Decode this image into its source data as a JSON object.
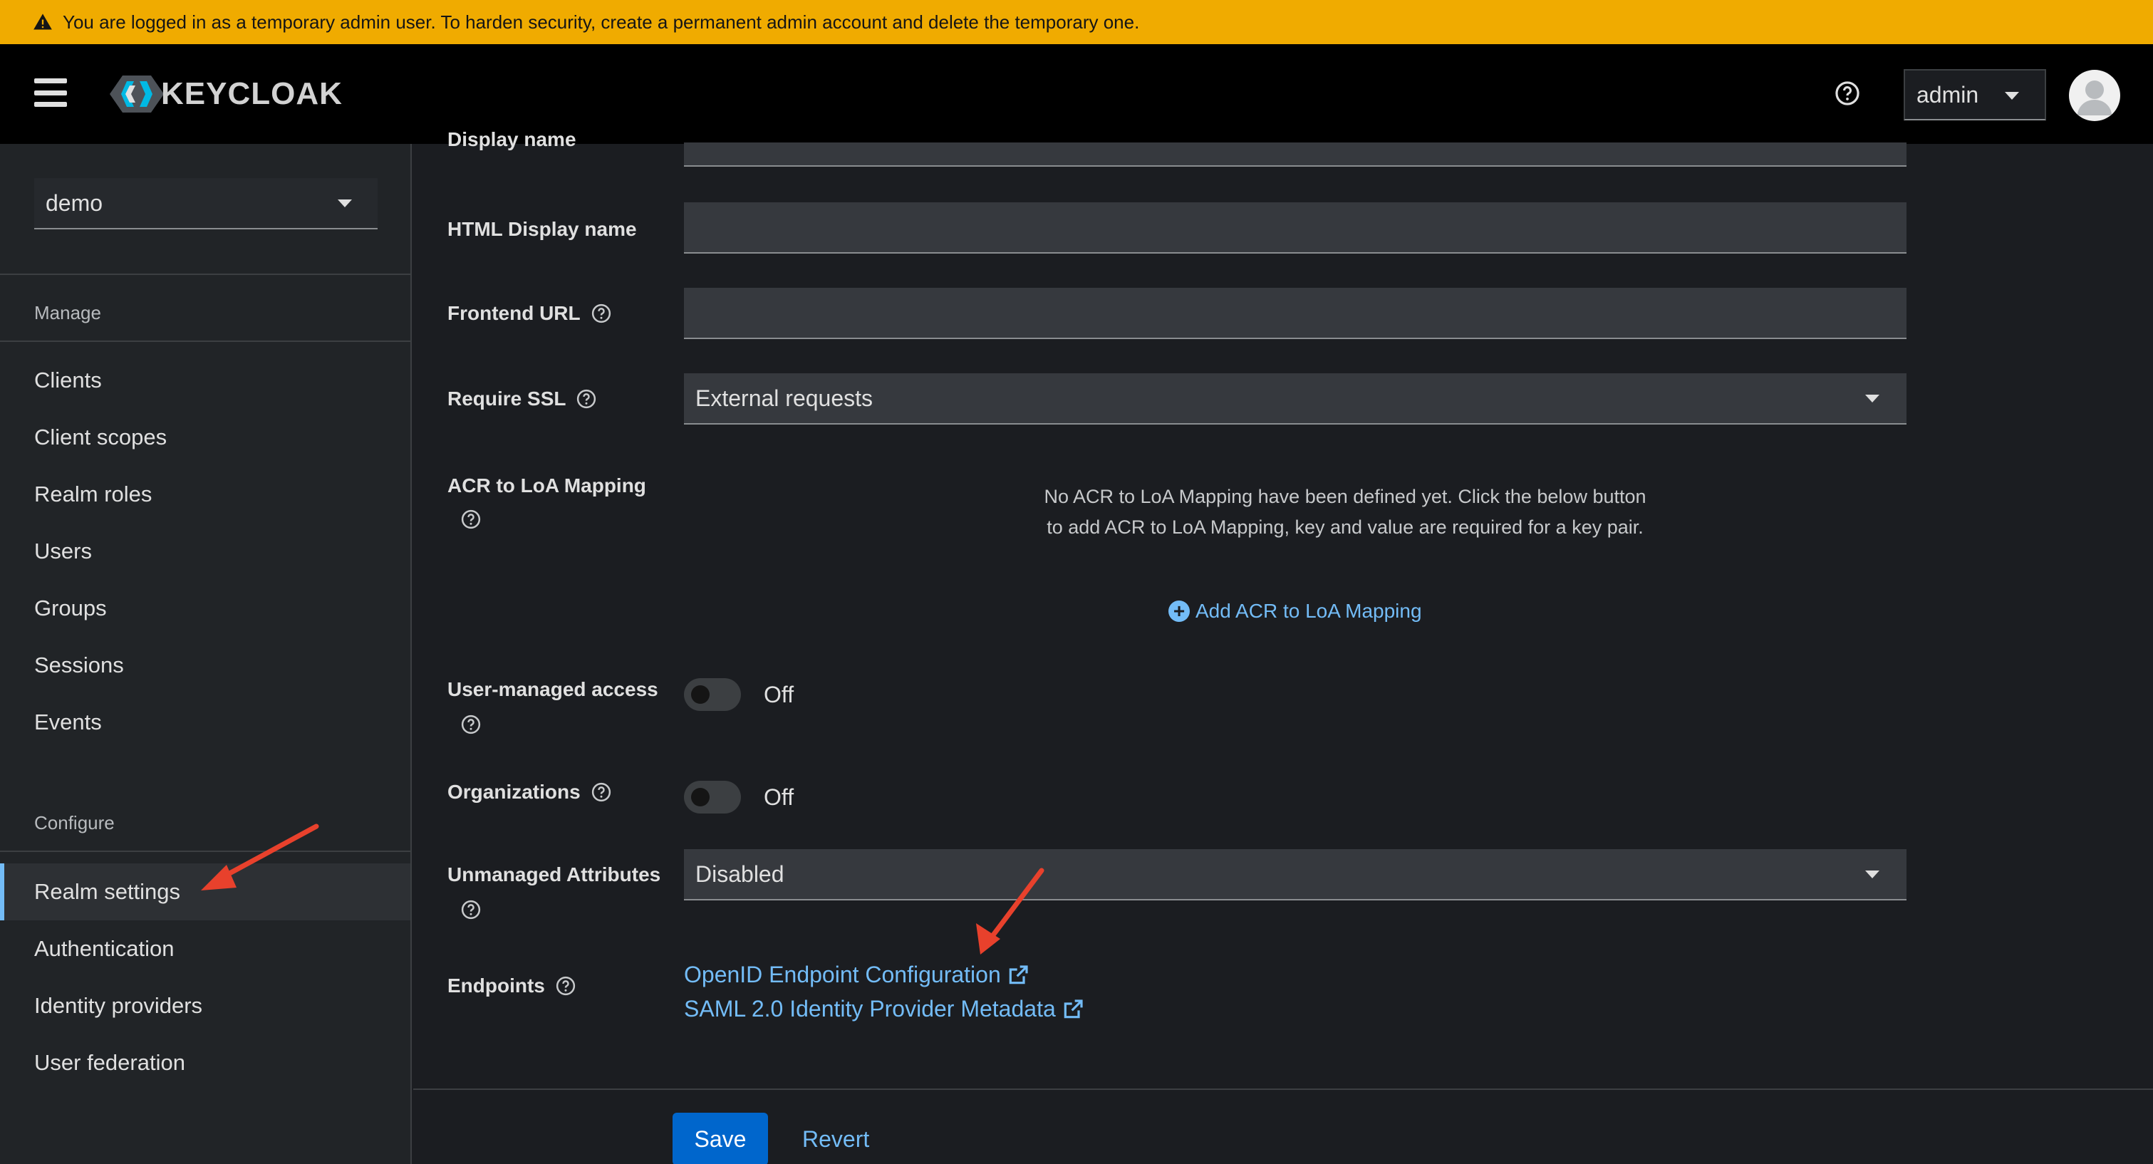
{
  "banner": {
    "text": "You are logged in as a temporary admin user. To harden security, create a permanent admin account and delete the temporary one."
  },
  "masthead": {
    "logo_text": "KEYCLOAK",
    "user": "admin"
  },
  "sidebar": {
    "realm": "demo",
    "sections": [
      {
        "title": "Manage",
        "items": [
          "Clients",
          "Client scopes",
          "Realm roles",
          "Users",
          "Groups",
          "Sessions",
          "Events"
        ]
      },
      {
        "title": "Configure",
        "items": [
          "Realm settings",
          "Authentication",
          "Identity providers",
          "User federation"
        ]
      }
    ],
    "active_item": "Realm settings"
  },
  "form": {
    "display_name_label": "Display name",
    "html_display_name_label": "HTML Display name",
    "frontend_url_label": "Frontend URL",
    "require_ssl_label": "Require SSL",
    "require_ssl_value": "External requests",
    "acr_label": "ACR to LoA Mapping",
    "acr_empty_text": "No ACR to LoA Mapping have been defined yet. Click the below button to add ACR to LoA Mapping, key and value are required for a key pair.",
    "acr_add_label": "Add ACR to LoA Mapping",
    "user_managed_access_label": "User-managed access",
    "user_managed_access_value": "Off",
    "organizations_label": "Organizations",
    "organizations_value": "Off",
    "unmanaged_attributes_label": "Unmanaged Attributes",
    "unmanaged_attributes_value": "Disabled",
    "endpoints_label": "Endpoints",
    "endpoint_openid": "OpenID Endpoint Configuration",
    "endpoint_saml": "SAML 2.0 Identity Provider Metadata",
    "save_label": "Save",
    "revert_label": "Revert"
  },
  "colors": {
    "banner": "#f0ab00",
    "link": "#73bcf7",
    "primary": "#0066cc",
    "arrow": "#e8412c"
  }
}
